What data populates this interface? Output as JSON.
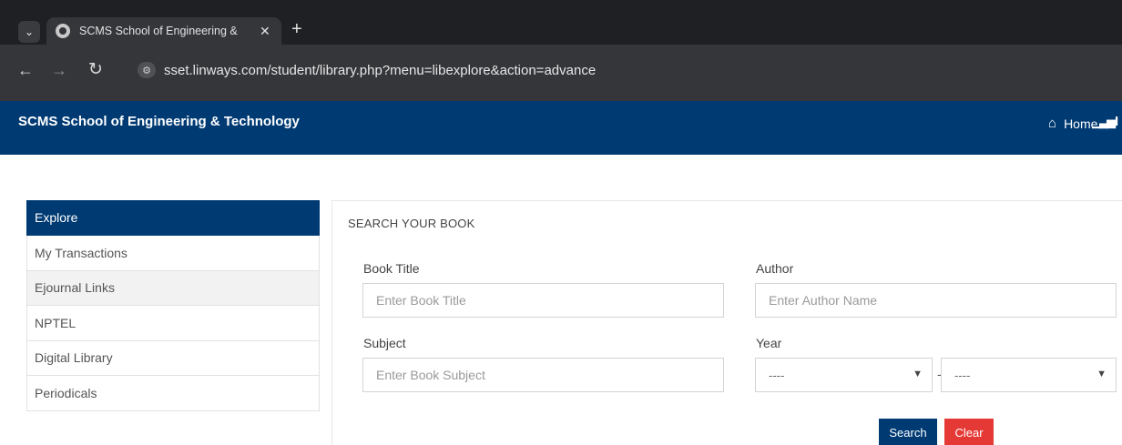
{
  "browser": {
    "tab_title": "SCMS School of Engineering &",
    "tab_close": "✕",
    "new_tab": "+",
    "url": "sset.linways.com/student/library.php?menu=libexplore&action=advance"
  },
  "header": {
    "site_title": "SCMS School of Engineering & Technology",
    "home_label": "Home",
    "cut_label": "I"
  },
  "sidebar": {
    "items": [
      {
        "label": "Explore"
      },
      {
        "label": "My Transactions"
      },
      {
        "label": "Ejournal Links"
      },
      {
        "label": "NPTEL"
      },
      {
        "label": "Digital Library"
      },
      {
        "label": "Periodicals"
      }
    ]
  },
  "search": {
    "title": "SEARCH YOUR BOOK",
    "book_title_label": "Book Title",
    "book_title_placeholder": "Enter Book Title",
    "author_label": "Author",
    "author_placeholder": "Enter Author Name",
    "subject_label": "Subject",
    "subject_placeholder": "Enter Book Subject",
    "year_label": "Year",
    "year_from_value": "----",
    "year_to_value": "----",
    "year_separator": "-",
    "search_label": "Search",
    "clear_label": "Clear"
  },
  "colors": {
    "brand": "#003a73",
    "clear_button": "#e53935"
  },
  "icons": {
    "tab_menu": "chevron-down-icon",
    "favicon": "globe-icon",
    "back": "arrow-left-icon",
    "forward": "arrow-right-icon",
    "reload": "reload-icon",
    "site_info": "tune-icon",
    "home": "home-icon",
    "chart": "signal-bars-icon"
  }
}
